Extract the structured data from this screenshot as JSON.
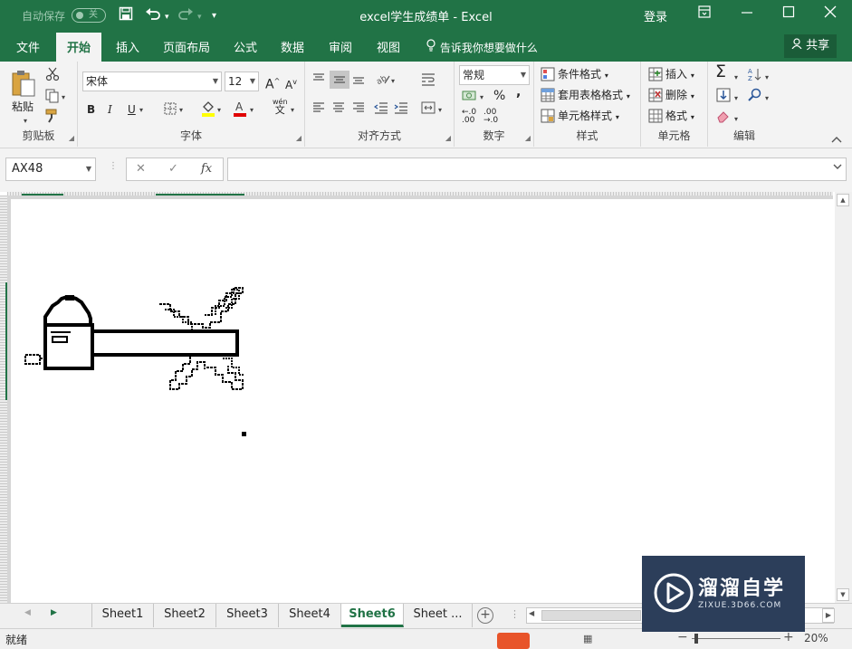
{
  "titlebar": {
    "autosave_label": "自动保存",
    "autosave_state": "关",
    "title": "excel学生成绩单  -  Excel",
    "login": "登录",
    "qa_save_icon": "save-icon",
    "qa_undo_icon": "undo-icon",
    "qa_redo_icon": "redo-icon"
  },
  "tabs": {
    "items": [
      "文件",
      "开始",
      "插入",
      "页面布局",
      "公式",
      "数据",
      "审阅",
      "视图"
    ],
    "tell_me": "告诉我你想要做什么",
    "share": "共享"
  },
  "ribbon": {
    "clipboard": {
      "paste": "粘贴",
      "label": "剪贴板"
    },
    "font": {
      "name": "宋体",
      "size": "12",
      "bold": "B",
      "italic": "I",
      "underline": "U",
      "label": "字体",
      "phonetic_top": "wén",
      "phonetic_bottom": "文"
    },
    "align": {
      "label": "对齐方式"
    },
    "number": {
      "format": "常规",
      "percent": "%",
      "comma": ",",
      "inc_dec": ".0",
      "label": "数字"
    },
    "styles": {
      "cond": "条件格式",
      "table": "套用表格格式",
      "cell": "单元格样式",
      "label": "样式"
    },
    "cells": {
      "insert": "插入",
      "delete": "删除",
      "format": "格式",
      "label": "单元格"
    },
    "edit": {
      "label": "编辑"
    }
  },
  "formula": {
    "namebox": "AX48",
    "cancel": "✕",
    "confirm": "✓",
    "fx": "fx",
    "content": ""
  },
  "sheets": {
    "items": [
      "Sheet1",
      "Sheet2",
      "Sheet3",
      "Sheet4",
      "Sheet6",
      "Sheet ..."
    ],
    "active": "Sheet6",
    "add": "+"
  },
  "status": {
    "ready": "就绪",
    "zoom": "20%"
  },
  "watermark": {
    "brand": "溜溜自学",
    "url": "ZIXUE.3D66.COM"
  },
  "colors": {
    "accent": "#217346",
    "watermark_bg": "#2c3e5a"
  }
}
